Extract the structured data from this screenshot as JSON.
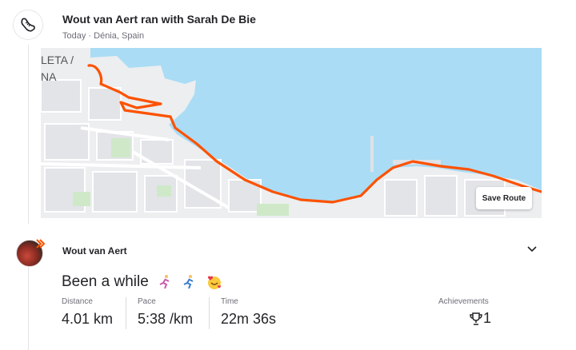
{
  "header": {
    "title": "Wout van Aert ran with Sarah De Bie",
    "subtitle": "Today · Dénia, Spain",
    "icon": "running-shoe-icon"
  },
  "map": {
    "label_top": "LETA /",
    "label_bottom": "NA",
    "save_route_label": "Save Route",
    "colors": {
      "route": "#fc5200",
      "water": "#aadcf5",
      "land": "#eceef0",
      "park": "#cfe9c8"
    }
  },
  "activity": {
    "athlete": "Wout van Aert",
    "title": "Been a while",
    "stats": [
      {
        "label": "Distance",
        "value": "4.01 km"
      },
      {
        "label": "Pace",
        "value": "5:38 /km"
      },
      {
        "label": "Time",
        "value": "22m 36s"
      }
    ],
    "achievements": {
      "label": "Achievements",
      "value": "1",
      "icon": "trophy-icon"
    }
  }
}
